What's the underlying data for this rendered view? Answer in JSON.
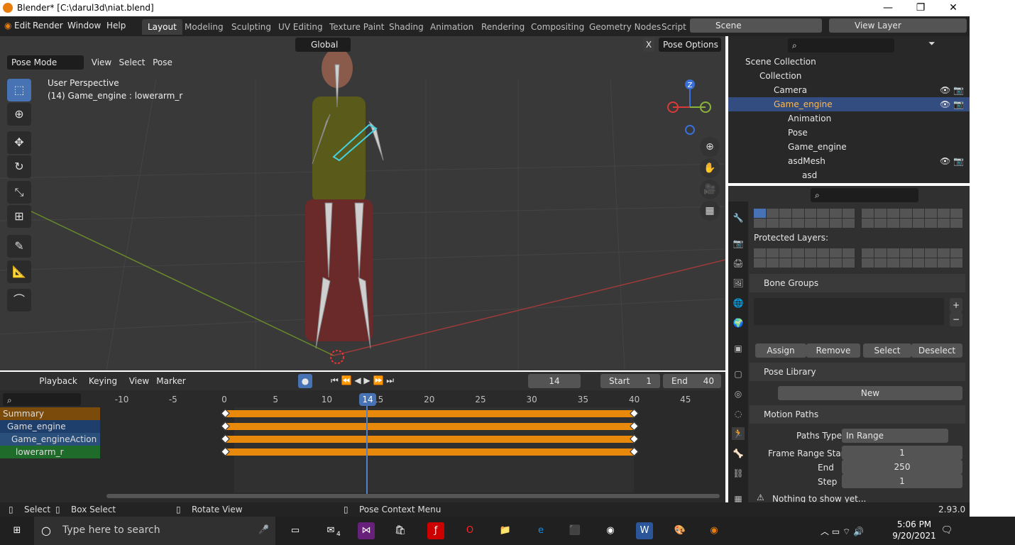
{
  "titlebar": {
    "title": "Blender* [C:\\darul3d\\niat.blend]",
    "min": "—",
    "max": "❐",
    "close": "✕"
  },
  "menu": {
    "edit": "Edit",
    "render": "Render",
    "window": "Window",
    "help": "Help"
  },
  "workspaces": [
    "Layout",
    "Modeling",
    "Sculpting",
    "UV Editing",
    "Texture Paint",
    "Shading",
    "Animation",
    "Rendering",
    "Compositing",
    "Geometry Nodes",
    "Script"
  ],
  "scene": {
    "name": "Scene",
    "view_layer": "View Layer"
  },
  "viewport": {
    "mode": "Pose Mode",
    "menus": [
      "View",
      "Select",
      "Pose"
    ],
    "orientation": "Global",
    "pose_options": "Pose Options",
    "x_label": "X",
    "info_line1": "User Perspective",
    "info_line2": "(14) Game_engine : lowerarm_r",
    "gizmo": {
      "z": "Z"
    }
  },
  "timeline": {
    "playback": "Playback",
    "keying": "Keying",
    "view": "View",
    "marker": "Marker",
    "frame": "14",
    "start_label": "Start",
    "start": "1",
    "end_label": "End",
    "end": "40",
    "ticks": [
      "-10",
      "-5",
      "0",
      "5",
      "10",
      "15",
      "20",
      "25",
      "30",
      "35",
      "40",
      "45"
    ],
    "current_frame": "14",
    "channels": [
      {
        "label": "Summary",
        "color": "#7a4b0a"
      },
      {
        "label": "Game_engine",
        "color": "#1e3e6b"
      },
      {
        "label": "Game_engineAction",
        "color": "#2a4f7a"
      },
      {
        "label": "lowerarm_r",
        "color": "#1f6b2a"
      }
    ]
  },
  "status": {
    "select": "Select",
    "box_select": "Box Select",
    "rotate_view": "Rotate View",
    "pose_context": "Pose Context Menu",
    "version": "2.93.0"
  },
  "outliner": {
    "rows": [
      {
        "label": "Scene Collection",
        "indent": 0
      },
      {
        "label": "Collection",
        "indent": 1
      },
      {
        "label": "Camera",
        "indent": 2
      },
      {
        "label": "Game_engine",
        "indent": 2,
        "selected": true
      },
      {
        "label": "Animation",
        "indent": 3
      },
      {
        "label": "Pose",
        "indent": 3
      },
      {
        "label": "Game_engine",
        "indent": 3
      },
      {
        "label": "asdMesh",
        "indent": 3
      },
      {
        "label": "asd",
        "indent": 4
      }
    ]
  },
  "properties": {
    "protected_layers": "Protected Layers:",
    "bone_groups": "Bone Groups",
    "assign": "Assign",
    "remove": "Remove",
    "select": "Select",
    "deselect": "Deselect",
    "pose_library": "Pose Library",
    "new": "New",
    "motion_paths": "Motion Paths",
    "paths_type_label": "Paths Type",
    "paths_type": "In Range",
    "frame_range_start_label": "Frame Range Start",
    "frame_range_start": "1",
    "end_label": "End",
    "end": "250",
    "step_label": "Step",
    "step": "1",
    "nothing": "Nothing to show yet..."
  },
  "taskbar": {
    "search": "Type here to search",
    "time": "5:06 PM",
    "date": "9/20/2021",
    "mail_badge": "4"
  }
}
